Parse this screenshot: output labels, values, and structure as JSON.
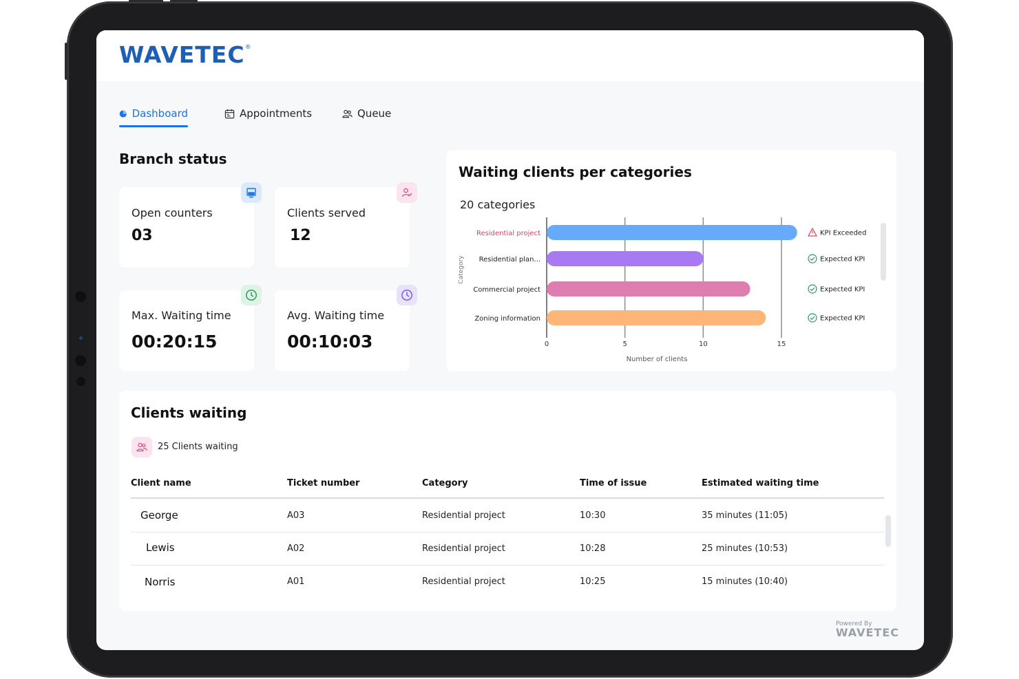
{
  "brand": {
    "logo_text": "WAVETEC",
    "logo_mark": "®",
    "powered_by": "Powered By",
    "powered_logo": "WAVETEC"
  },
  "tabs": [
    {
      "label": "Dashboard",
      "icon": "pie-chart-icon",
      "active": true
    },
    {
      "label": "Appointments",
      "icon": "calendar-icon",
      "active": false
    },
    {
      "label": "Queue",
      "icon": "users-icon",
      "active": false
    }
  ],
  "branch_status": {
    "title": "Branch status",
    "cards": [
      {
        "label": "Open counters",
        "value": "03",
        "icon": "monitor-icon",
        "badge_color": "#dbe9fb",
        "icon_color": "#1a73e8"
      },
      {
        "label": "Clients served",
        "value": "12",
        "icon": "user-check-icon",
        "badge_color": "#fbe4ee",
        "icon_color": "#d64f8a"
      },
      {
        "label": "Max. Waiting time",
        "value": "00:20:15",
        "icon": "clock-icon",
        "badge_color": "#dff2e6",
        "icon_color": "#2e9c5a"
      },
      {
        "label": "Avg. Waiting time",
        "value": "00:10:03",
        "icon": "clock-icon",
        "badge_color": "#e8e3fb",
        "icon_color": "#7a5ce0"
      }
    ]
  },
  "chart_panel": {
    "title": "Waiting clients per categories",
    "subtitle": "20 categories",
    "chart_data": {
      "type": "bar",
      "orientation": "horizontal",
      "categories": [
        "Residential project",
        "Residential plan...",
        "Commercial project",
        "Zoning information"
      ],
      "values": [
        16,
        10,
        13,
        14
      ],
      "colors": [
        "#66aaf9",
        "#a77af4",
        "#e07db0",
        "#fdb677"
      ],
      "status": [
        "KPI Exceeded",
        "Expected KPI",
        "Expected KPI",
        "Expected KPI"
      ],
      "status_icons": [
        "warning-icon",
        "check-circle-icon",
        "check-circle-icon",
        "check-circle-icon"
      ],
      "highlight_category_color": "#e0435a",
      "xlabel": "Number of clients",
      "ylabel": "Category",
      "xticks": [
        "0",
        "5",
        "10",
        "15"
      ],
      "xlim": [
        0,
        15
      ],
      "grid": true
    }
  },
  "clients_waiting": {
    "title": "Clients waiting",
    "count_text": "25 Clients waiting",
    "count_icon": "users-icon",
    "columns": [
      "Client name",
      "Ticket number",
      "Category",
      "Time of issue",
      "Estimated waiting time"
    ],
    "rows": [
      [
        "George",
        "A03",
        "Residential project",
        "10:30",
        "35 minutes (11:05)"
      ],
      [
        "Lewis",
        "A02",
        "Residential project",
        "10:28",
        "25 minutes (10:53)"
      ],
      [
        "Norris",
        "A01",
        "Residential project",
        "10:25",
        "15 minutes (10:40)"
      ]
    ]
  }
}
